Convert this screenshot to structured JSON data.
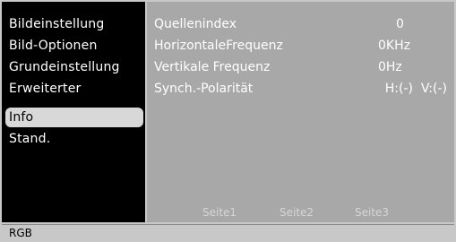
{
  "sidebar": {
    "items": [
      {
        "label": "Bildeinstellung"
      },
      {
        "label": "Bild-Optionen"
      },
      {
        "label": "Grundeinstellung"
      },
      {
        "label": "Erweiterter"
      },
      {
        "label": "Info"
      },
      {
        "label": "Stand."
      }
    ],
    "selected_label": "Info"
  },
  "info": {
    "rows": [
      {
        "label": "Quellenindex",
        "value": "0"
      },
      {
        "label": "HorizontaleFrequenz",
        "value": "0KHz"
      },
      {
        "label": "Vertikale Frequenz",
        "value": "0Hz"
      },
      {
        "label": "Synch.-Polarität",
        "value": "H:(-)  V:(-)"
      }
    ]
  },
  "pages": [
    "Seite1",
    "Seite2",
    "Seite3"
  ],
  "status": {
    "source": "RGB"
  },
  "colors": {
    "sidebar_bg": "#000000",
    "content_bg": "#a8a8a8",
    "selected_bg": "#d8d8d8",
    "statusbar_bg": "#c8c8c8"
  }
}
